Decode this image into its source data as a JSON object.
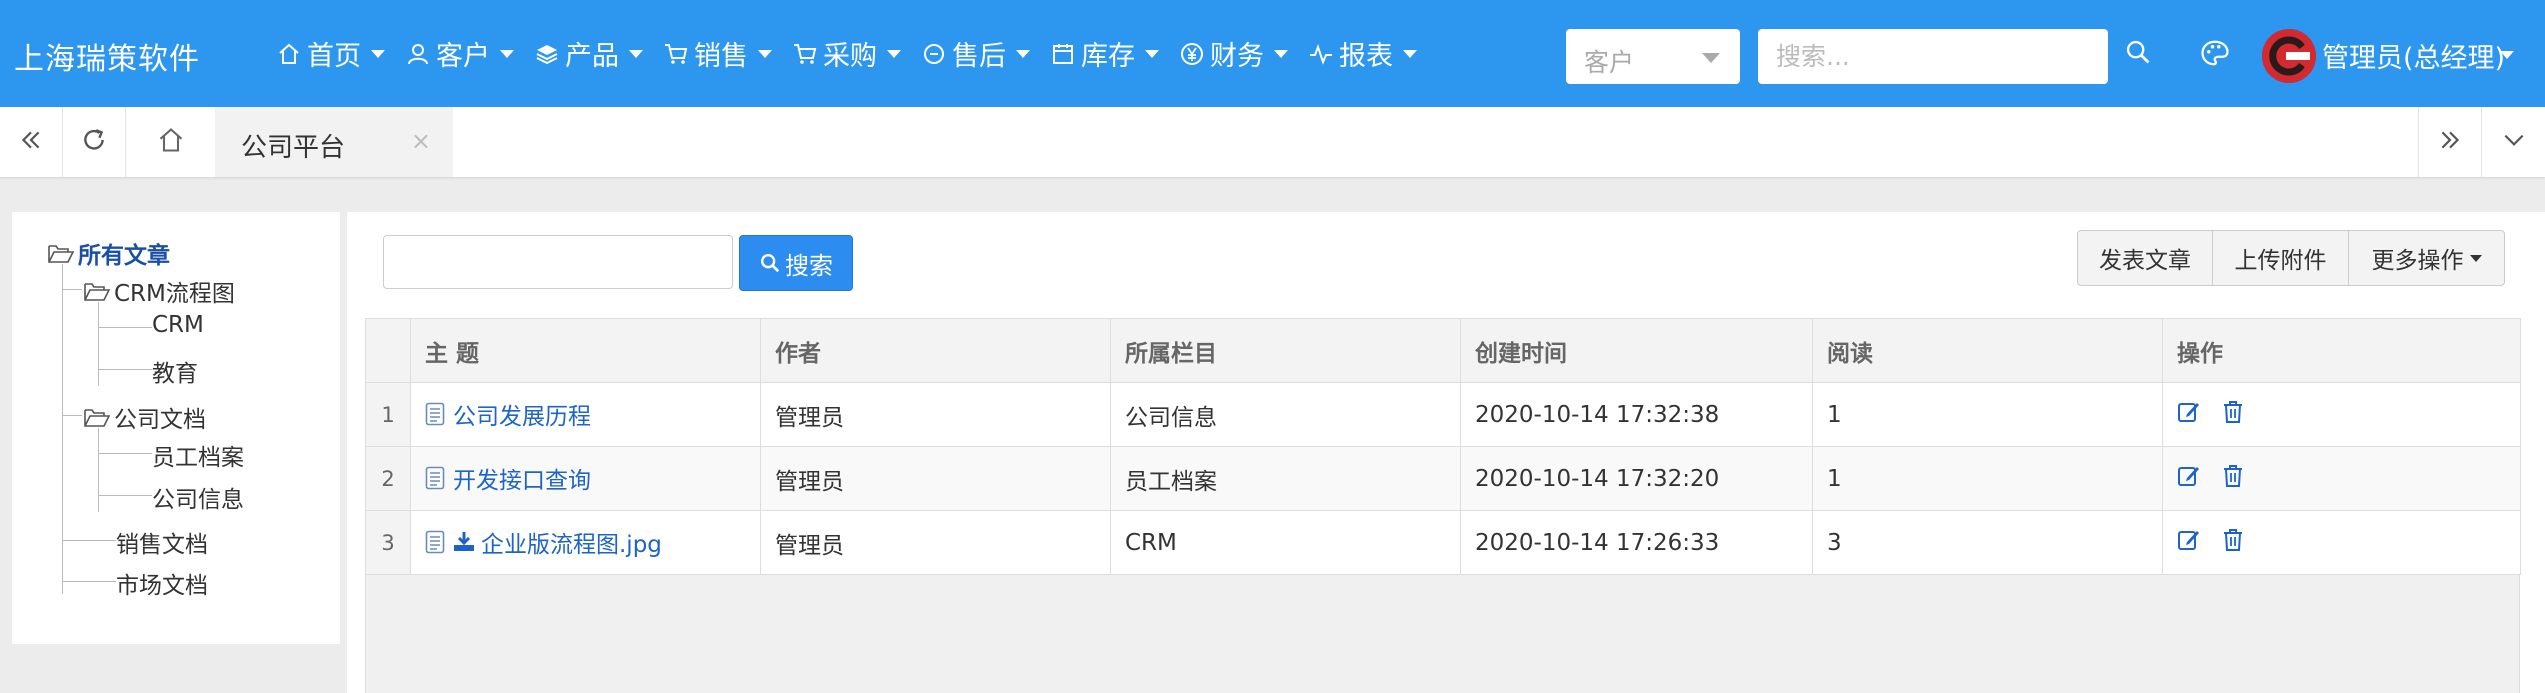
{
  "app": {
    "brand": "上海瑞策软件"
  },
  "nav": [
    {
      "label": "首页",
      "icon": "home-icon"
    },
    {
      "label": "客户",
      "icon": "user-icon"
    },
    {
      "label": "产品",
      "icon": "layers-icon"
    },
    {
      "label": "销售",
      "icon": "cart-icon"
    },
    {
      "label": "采购",
      "icon": "cart-icon"
    },
    {
      "label": "售后",
      "icon": "circle-icon"
    },
    {
      "label": "库存",
      "icon": "calendar-icon"
    },
    {
      "label": "财务",
      "icon": "yen-icon"
    },
    {
      "label": "报表",
      "icon": "pulse-icon"
    }
  ],
  "header": {
    "search_scope": "客户",
    "search_placeholder": "搜索...",
    "user_name": "管理员(总经理)"
  },
  "tabs": {
    "active_label": "公司平台",
    "close_glyph": "×"
  },
  "tree": {
    "root": "所有文章",
    "crm_folder": "CRM流程图",
    "crm_child_1": "CRM",
    "crm_child_2": "教育",
    "company_folder": "公司文档",
    "company_child_1": "员工档案",
    "company_child_2": "公司信息",
    "sales_docs": "销售文档",
    "market_docs": "市场文档"
  },
  "toolbar": {
    "search_label": "搜索",
    "publish_label": "发表文章",
    "upload_label": "上传附件",
    "more_label": "更多操作"
  },
  "table": {
    "headers": [
      "主 题",
      "作者",
      "所属栏目",
      "创建时间",
      "阅读",
      "操作"
    ],
    "rows": [
      {
        "index": "1",
        "subject": "公司发展历程",
        "author": "管理员",
        "category": "公司信息",
        "created": "2020-10-14 17:32:38",
        "reads": "1"
      },
      {
        "index": "2",
        "subject": "开发接口查询",
        "author": "管理员",
        "category": "员工档案",
        "created": "2020-10-14 17:32:20",
        "reads": "1"
      },
      {
        "index": "3",
        "subject": "企业版流程图.jpg",
        "author": "管理员",
        "category": "CRM",
        "created": "2020-10-14 17:26:33",
        "reads": "3"
      }
    ]
  },
  "colors": {
    "topbar": "#2d97f0",
    "accent_button": "#2d8cf0",
    "link": "#1e64c8"
  }
}
